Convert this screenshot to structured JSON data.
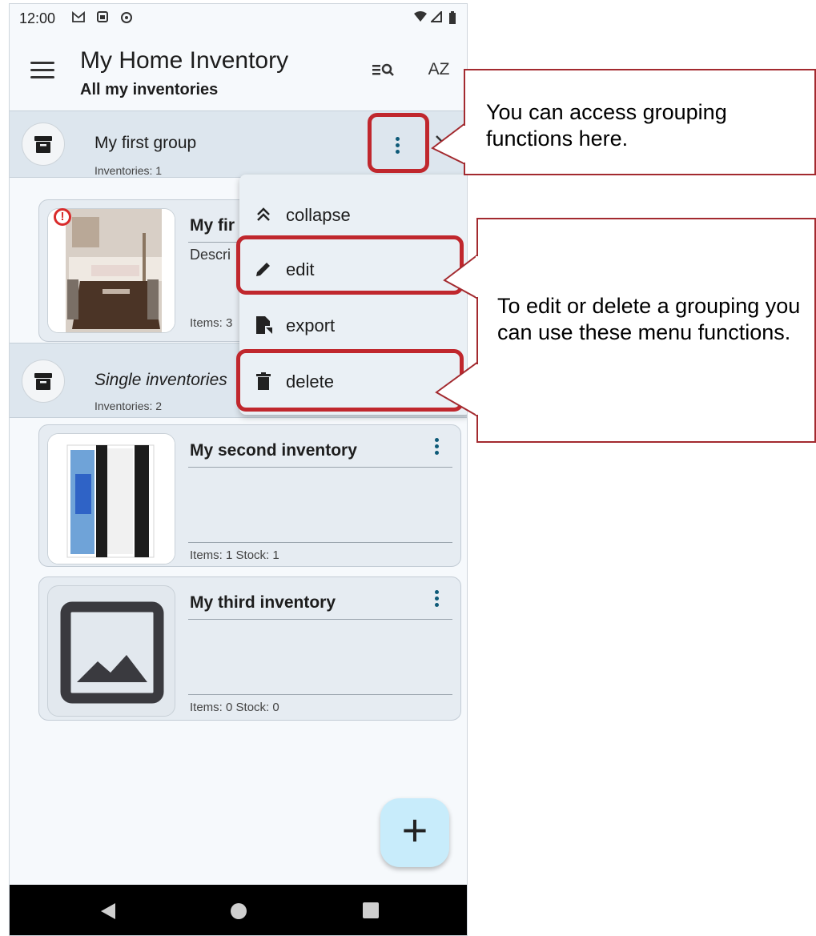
{
  "status_bar": {
    "time": "12:00",
    "notif_icons": [
      "gmail-icon",
      "photo-icon",
      "sync-icon"
    ],
    "system_icons": [
      "wifi-icon",
      "signal-icon",
      "battery-icon"
    ]
  },
  "app_bar": {
    "title": "My Home Inventory",
    "subtitle": "All my inventories",
    "menu_icon": "hamburger-menu-icon",
    "search_icon": "filter-search-icon",
    "sort_label": "AZ"
  },
  "groups": [
    {
      "title": "My first group",
      "count_label": "Inventories: 1"
    },
    {
      "title": "Single inventories",
      "count_label": "Inventories: 2"
    }
  ],
  "inventories": [
    {
      "title": "My first inventory",
      "title_visible": "My fir",
      "description_visible": "Descri",
      "stats_visible": "Items: 3",
      "has_warning": true,
      "warning_glyph": "!"
    },
    {
      "title": "My second inventory",
      "stats": "Items: 1   Stock: 1"
    },
    {
      "title": "My third inventory",
      "stats": "Items: 0   Stock: 0"
    }
  ],
  "context_menu": {
    "items": [
      {
        "label": "collapse",
        "icon": "chevron-double-up-icon"
      },
      {
        "label": "edit",
        "icon": "pencil-icon"
      },
      {
        "label": "export",
        "icon": "file-export-icon"
      },
      {
        "label": "delete",
        "icon": "trash-icon"
      }
    ]
  },
  "fab": {
    "label": "+"
  },
  "annotations": {
    "callout_1": "You can access grouping functions here.",
    "callout_2": "To edit or delete a grouping you can use these menu functions."
  },
  "colors": {
    "highlight": "#c0272d",
    "group_bg": "#dde6ee",
    "card_bg": "#e6ecf2",
    "fab_bg": "#c8ecfb",
    "dots": "#0e5a78"
  }
}
